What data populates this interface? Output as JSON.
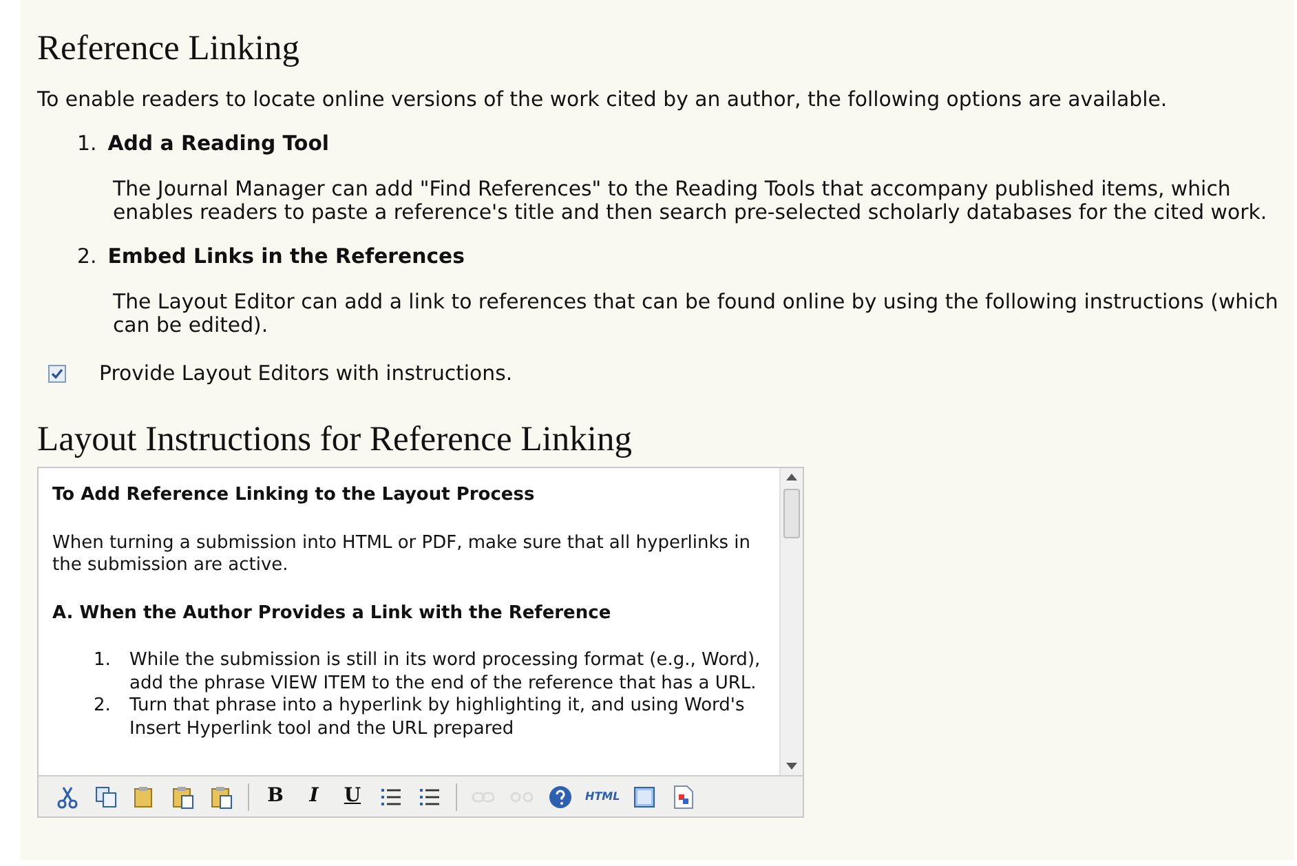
{
  "title": "Reference Linking",
  "intro": "To enable readers to locate online versions of the work cited by an author, the following options are available.",
  "options": [
    {
      "number": "1.",
      "heading": "Add a Reading Tool",
      "text": "The Journal Manager can add \"Find References\" to the Reading Tools that accompany published items, which enables readers to paste a reference's title and then search pre-selected scholarly databases for the cited work."
    },
    {
      "number": "2.",
      "heading": "Embed Links in the References",
      "text": "The Layout Editor can add a link to references that can be found online by using the following instructions (which can be edited)."
    }
  ],
  "checkbox": {
    "label": "Provide Layout Editors with instructions.",
    "checked": true
  },
  "instructions_title": "Layout Instructions for Reference Linking",
  "editor": {
    "content": [
      {
        "kind": "heading",
        "text": "To Add Reference Linking to the Layout Process"
      },
      {
        "kind": "paragraph",
        "text": "When turning a submission into HTML or PDF, make sure that all hyperlinks in the submission are active."
      },
      {
        "kind": "heading",
        "text": "A. When the Author Provides a Link with the Reference"
      },
      {
        "kind": "list",
        "items": [
          {
            "number": "1.",
            "text": "While the submission is still in its word processing format (e.g., Word), add the phrase VIEW ITEM to the end of the reference that has a URL."
          },
          {
            "number": "2.",
            "text": "Turn that phrase into a hyperlink by highlighting it, and using Word's Insert Hyperlink tool and the URL prepared"
          }
        ]
      }
    ],
    "toolbar": [
      {
        "kind": "cut",
        "disabled": false
      },
      {
        "kind": "copy",
        "disabled": false
      },
      {
        "kind": "paste",
        "disabled": false
      },
      {
        "kind": "paste-text",
        "disabled": false
      },
      {
        "kind": "paste-word",
        "disabled": false
      },
      {
        "kind": "separator"
      },
      {
        "kind": "bold",
        "label": "B",
        "disabled": false
      },
      {
        "kind": "italic",
        "label": "I",
        "disabled": false
      },
      {
        "kind": "underline",
        "label": "U",
        "disabled": false
      },
      {
        "kind": "bullets",
        "disabled": false
      },
      {
        "kind": "numbers",
        "disabled": false
      },
      {
        "kind": "separator"
      },
      {
        "kind": "link",
        "disabled": true
      },
      {
        "kind": "unlink",
        "disabled": true
      },
      {
        "kind": "help",
        "disabled": false
      },
      {
        "kind": "text",
        "label": "HTML",
        "disabled": false
      },
      {
        "kind": "fullscreen",
        "disabled": false
      },
      {
        "kind": "page",
        "disabled": false
      }
    ]
  }
}
